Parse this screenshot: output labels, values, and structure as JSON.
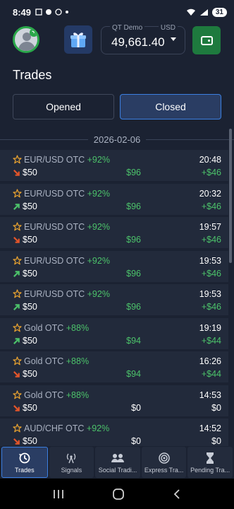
{
  "status": {
    "time": "8:49",
    "battery": "31"
  },
  "header": {
    "account": "QT Demo",
    "currency": "USD",
    "balance": "49,661.40"
  },
  "page": {
    "title": "Trades"
  },
  "tabs": {
    "opened": "Opened",
    "closed": "Closed"
  },
  "date_group": "2026-02-06",
  "colors": {
    "up": "#4cc26a",
    "down": "#e3552a",
    "star": "#e8a230",
    "accent": "#3b7fe0"
  },
  "trades": [
    {
      "asset": "EUR/USD OTC",
      "pct": "+92%",
      "time": "20:48",
      "dir": "down",
      "stake": "$50",
      "payout": "$96",
      "profit": "+$46"
    },
    {
      "asset": "EUR/USD OTC",
      "pct": "+92%",
      "time": "20:32",
      "dir": "up",
      "stake": "$50",
      "payout": "$96",
      "profit": "+$46"
    },
    {
      "asset": "EUR/USD OTC",
      "pct": "+92%",
      "time": "19:57",
      "dir": "down",
      "stake": "$50",
      "payout": "$96",
      "profit": "+$46"
    },
    {
      "asset": "EUR/USD OTC",
      "pct": "+92%",
      "time": "19:53",
      "dir": "up",
      "stake": "$50",
      "payout": "$96",
      "profit": "+$46"
    },
    {
      "asset": "EUR/USD OTC",
      "pct": "+92%",
      "time": "19:53",
      "dir": "up",
      "stake": "$50",
      "payout": "$96",
      "profit": "+$46"
    },
    {
      "asset": "Gold OTC",
      "pct": "+88%",
      "time": "19:19",
      "dir": "up",
      "stake": "$50",
      "payout": "$94",
      "profit": "+$44"
    },
    {
      "asset": "Gold OTC",
      "pct": "+88%",
      "time": "16:26",
      "dir": "down",
      "stake": "$50",
      "payout": "$94",
      "profit": "+$44"
    },
    {
      "asset": "Gold OTC",
      "pct": "+88%",
      "time": "14:53",
      "dir": "down",
      "stake": "$50",
      "payout": "$0",
      "profit": "$0"
    },
    {
      "asset": "AUD/CHF OTC",
      "pct": "+92%",
      "time": "14:52",
      "dir": "down",
      "stake": "$50",
      "payout": "$0",
      "profit": "$0"
    }
  ],
  "nav": [
    {
      "label": "Trades",
      "icon": "history-icon"
    },
    {
      "label": "Signals",
      "icon": "antenna-icon"
    },
    {
      "label": "Social Tradi...",
      "icon": "people-icon"
    },
    {
      "label": "Express Tra...",
      "icon": "target-icon"
    },
    {
      "label": "Pending Tra...",
      "icon": "hourglass-icon"
    }
  ]
}
